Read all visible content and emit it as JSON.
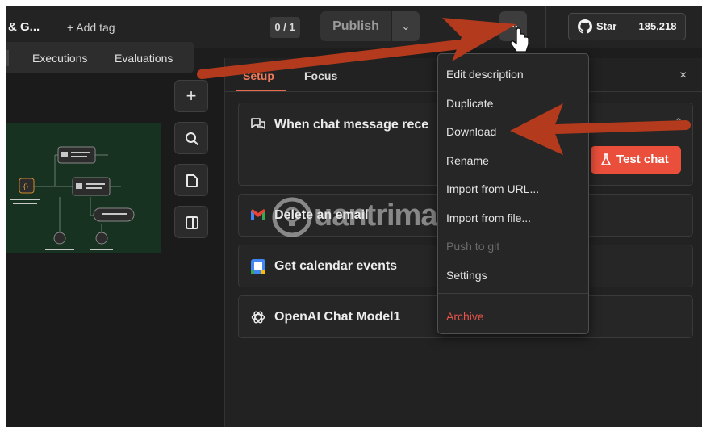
{
  "header": {
    "workflow_name": "& G...",
    "add_tag": "+ Add tag",
    "version_counter": "0 / 1",
    "publish_label": "Publish",
    "more_label": "...",
    "star_label": "Star",
    "star_count": "185,218"
  },
  "exec_tabs": {
    "executions": "Executions",
    "evaluations": "Evaluations"
  },
  "panel": {
    "tabs": {
      "setup": "Setup",
      "focus": "Focus"
    },
    "close": "×",
    "nodes": [
      {
        "title": "When chat message rece",
        "icon": "chat-icon"
      },
      {
        "title": "Delete an email",
        "icon": "gmail-icon"
      },
      {
        "title": "Get calendar events",
        "icon": "google-calendar-icon"
      },
      {
        "title": "OpenAI Chat Model1",
        "icon": "openai-icon"
      }
    ],
    "test_chat": "Test chat"
  },
  "menu": {
    "items": [
      {
        "label": "Edit description",
        "state": "enabled"
      },
      {
        "label": "Duplicate",
        "state": "enabled"
      },
      {
        "label": "Download",
        "state": "enabled"
      },
      {
        "label": "Rename",
        "state": "enabled"
      },
      {
        "label": "Import from URL...",
        "state": "enabled"
      },
      {
        "label": "Import from file...",
        "state": "enabled"
      },
      {
        "label": "Push to git",
        "state": "disabled"
      },
      {
        "label": "Settings",
        "state": "enabled"
      },
      {
        "label": "Archive",
        "state": "danger"
      }
    ]
  },
  "watermark": {
    "text": "uantrimang"
  },
  "colors": {
    "accent": "#ea4f3b",
    "arrow": "#b33a1c",
    "background": "#1d1d1d",
    "mini_canvas": "#173220"
  }
}
